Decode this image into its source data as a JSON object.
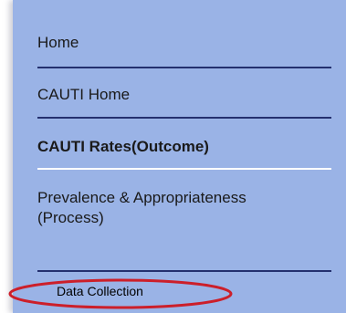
{
  "nav": {
    "items": [
      {
        "label": "Home"
      },
      {
        "label": "CAUTI Home"
      },
      {
        "label": "CAUTI Rates(Outcome)"
      },
      {
        "label": "Prevalence & Appropriateness (Process)"
      }
    ],
    "sub_item": {
      "label": "Data Collection"
    }
  },
  "colors": {
    "panel_bg": "#9ab3e6",
    "divider": "#24306f",
    "active_divider": "#ffffff",
    "highlight": "#cc1f2a"
  }
}
